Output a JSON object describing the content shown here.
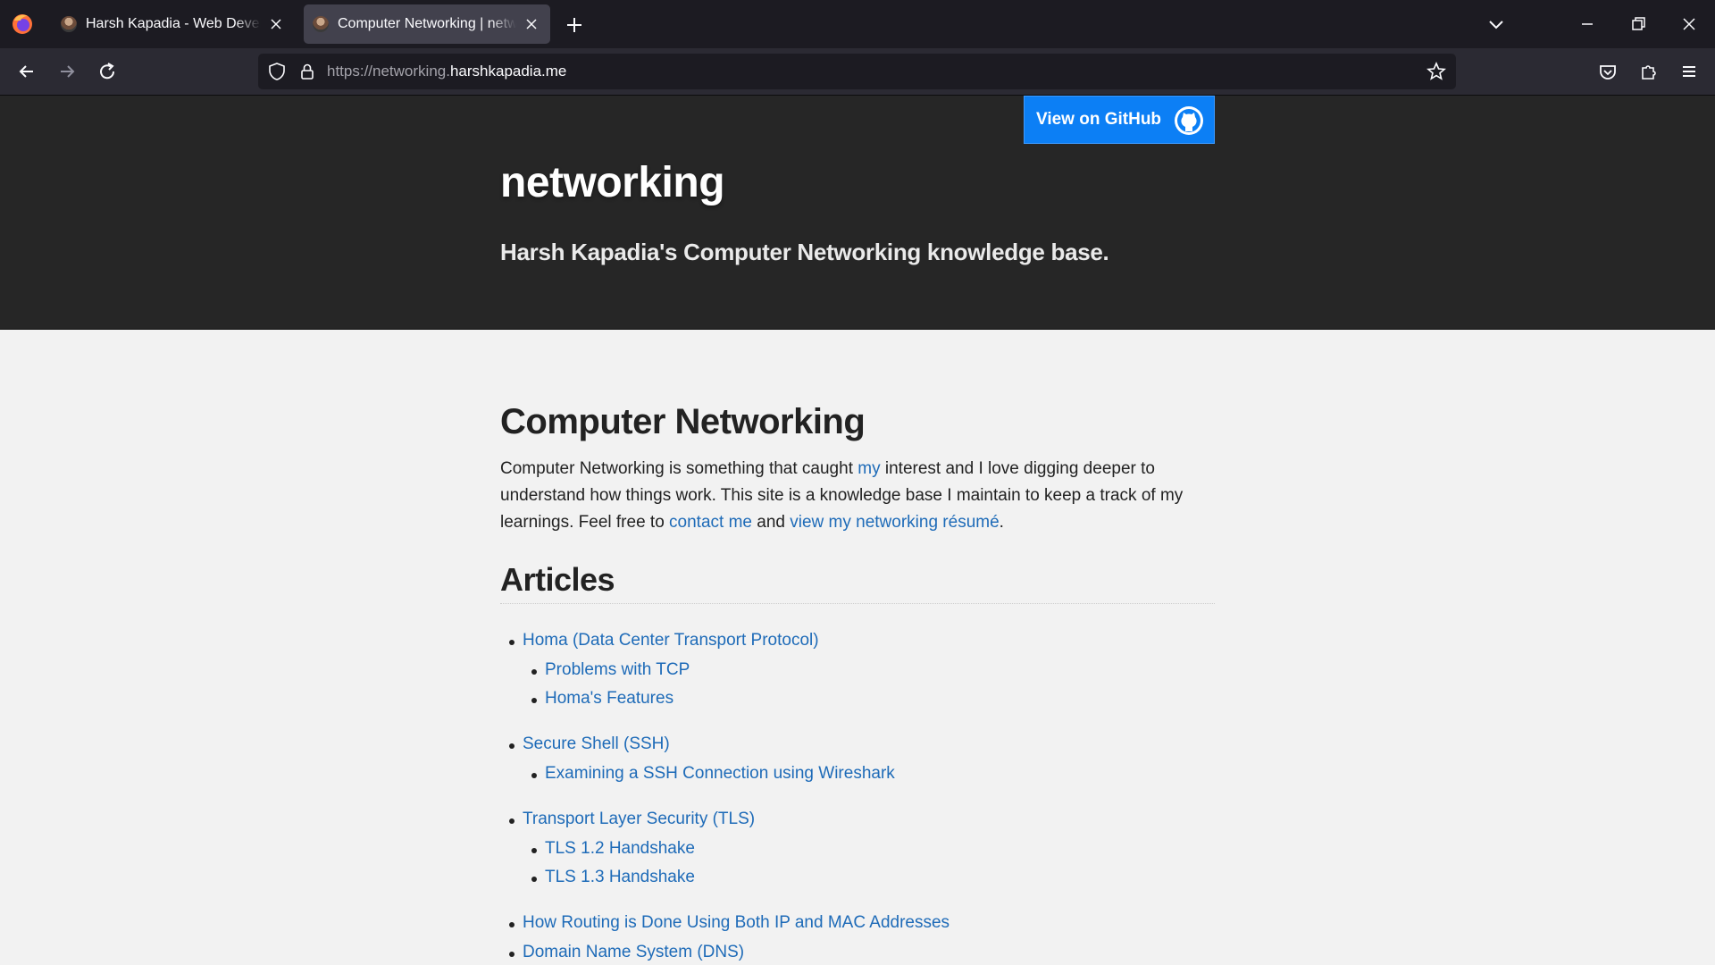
{
  "browser": {
    "tabs": [
      {
        "title": "Harsh Kapadia - Web Developer",
        "active": false
      },
      {
        "title": "Computer Networking | networking",
        "active": true
      }
    ],
    "url_prefix": "https://networking.",
    "url_domain": "harshkapadia.me"
  },
  "page": {
    "github_button": "View on GitHub",
    "site_name": "networking",
    "tagline": "Harsh Kapadia's Computer Networking knowledge base.",
    "heading": "Computer Networking",
    "intro": {
      "t1": "Computer Networking is something that caught ",
      "l1": "my",
      "t2": " interest and I love digging deeper to understand how things work. This site is a knowledge base I maintain to keep a track of my learnings. Feel free to ",
      "l2": "contact me",
      "t3": " and ",
      "l3": "view my networking résumé",
      "t4": "."
    },
    "articles_heading": "Articles",
    "articles": [
      {
        "label": "Homa (Data Center Transport Protocol)",
        "level": 1
      },
      {
        "label": "Problems with TCP",
        "level": 2
      },
      {
        "label": "Homa's Features",
        "level": 2
      },
      {
        "label": "Secure Shell (SSH)",
        "level": 1
      },
      {
        "label": "Examining a SSH Connection using Wireshark",
        "level": 2
      },
      {
        "label": "Transport Layer Security (TLS)",
        "level": 1
      },
      {
        "label": "TLS 1.2 Handshake",
        "level": 2
      },
      {
        "label": "TLS 1.3 Handshake",
        "level": 2
      },
      {
        "label": "How Routing is Done Using Both IP and MAC Addresses",
        "level": 1
      },
      {
        "label": "Domain Name System (DNS)",
        "level": 1
      }
    ]
  },
  "colors": {
    "link": "#1e6bb8",
    "github_button": "#0c7ff5",
    "hero_bg": "#262626"
  }
}
